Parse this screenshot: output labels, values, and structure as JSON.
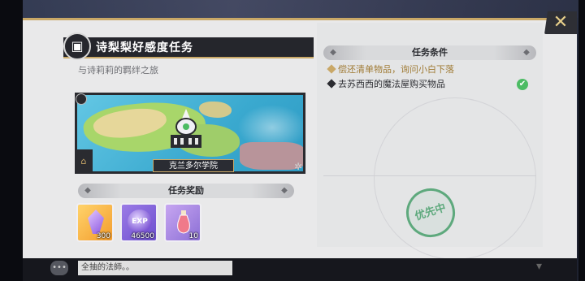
{
  "header": {
    "close_icon": "close-icon"
  },
  "quest": {
    "title": "诗梨梨好感度任务",
    "subtitle": "与诗莉莉的羁绊之旅",
    "map_location": "克兰多尔学院"
  },
  "conditions": {
    "header": "任务条件",
    "items": [
      {
        "text": "偿还清单物品，询问小白下落",
        "status": "active"
      },
      {
        "text": "去苏西西的魔法屋购买物品",
        "status": "done"
      }
    ]
  },
  "rewards": {
    "header": "任务奖励",
    "items": [
      {
        "name": "crystal",
        "count": "300"
      },
      {
        "name": "exp",
        "label": "EXP",
        "count": "46500"
      },
      {
        "name": "potion",
        "count": "10"
      }
    ]
  },
  "stamp": {
    "text": "优先中"
  },
  "chat": {
    "text": "全抽的法師。。"
  },
  "colors": {
    "accent_gold": "#c9a867",
    "done_green": "#4cbc64",
    "stamp_green": "#5ea97d"
  }
}
